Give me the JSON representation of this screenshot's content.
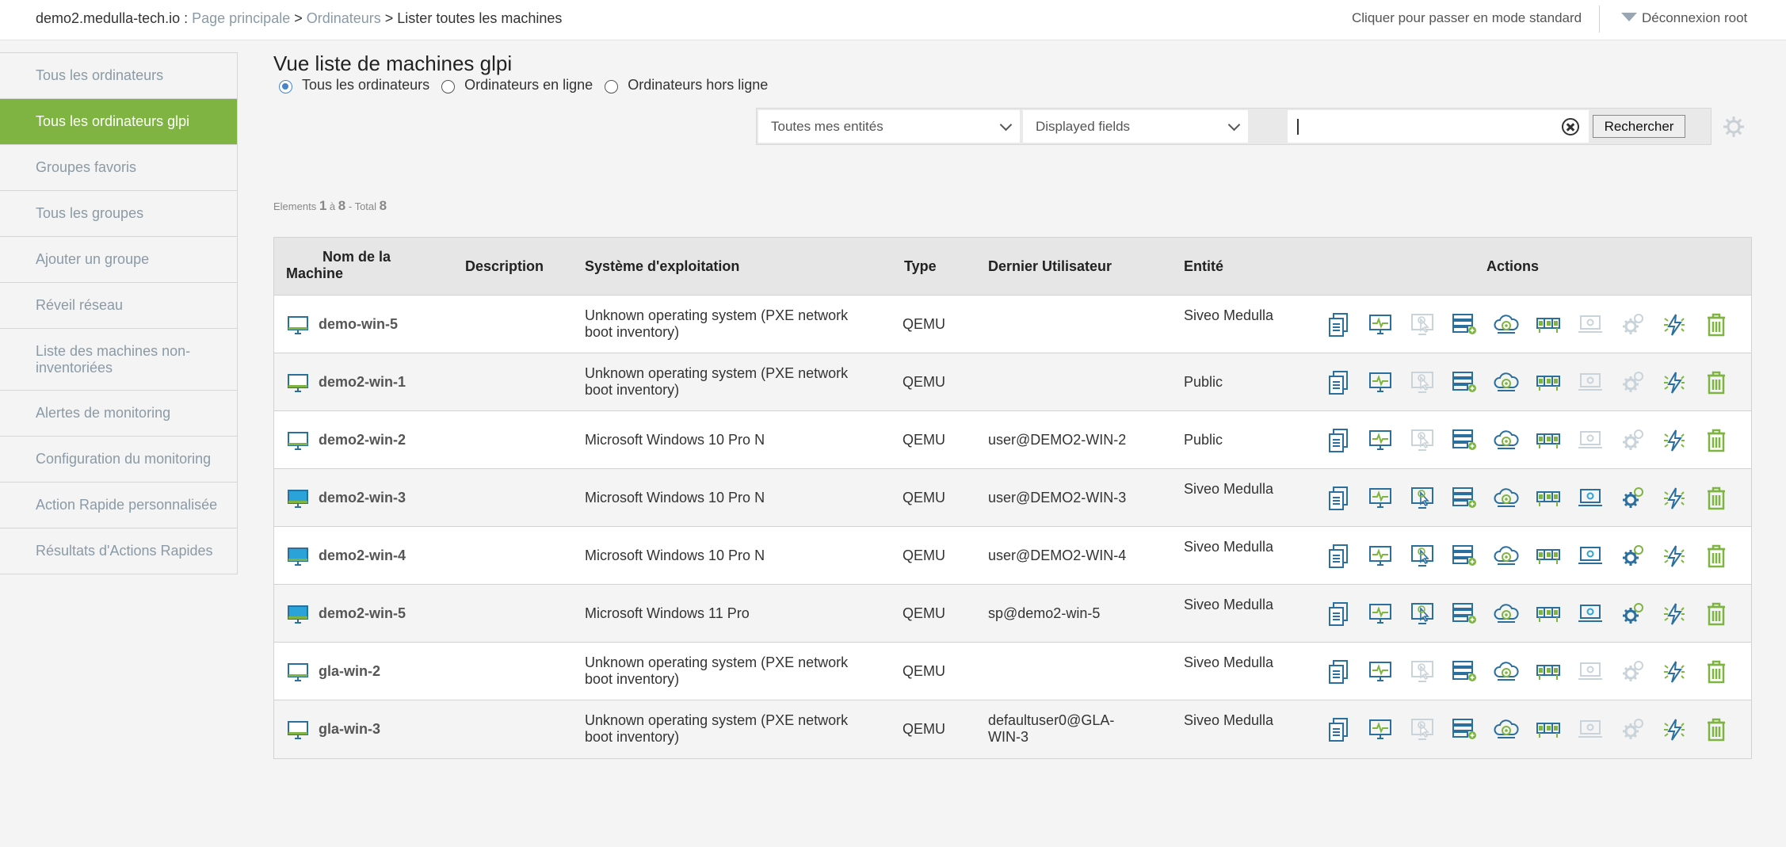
{
  "breadcrumb": {
    "host": "demo2.medulla-tech.io",
    "colon": " : ",
    "home": "Page principale",
    "computers": "Ordinateurs",
    "current": "Lister toutes les machines",
    "sep": " > "
  },
  "topbar": {
    "mode_link": "Cliquer pour passer en mode standard",
    "logout": "Déconnexion root"
  },
  "sidebar": {
    "items": [
      {
        "label": "Tous les ordinateurs"
      },
      {
        "label": "Tous les ordinateurs glpi",
        "active": true
      },
      {
        "label": "Groupes favoris"
      },
      {
        "label": "Tous les groupes"
      },
      {
        "label": "Ajouter un groupe"
      },
      {
        "label": "Réveil réseau"
      },
      {
        "label": "Liste des machines non-inventoriées"
      },
      {
        "label": "Alertes de monitoring"
      },
      {
        "label": "Configuration du monitoring"
      },
      {
        "label": "Action Rapide personnalisée"
      },
      {
        "label": "Résultats d'Actions Rapides"
      }
    ]
  },
  "main": {
    "title": "Vue liste de machines glpi",
    "radios": [
      {
        "label": "Tous les ordinateurs",
        "checked": true
      },
      {
        "label": "Ordinateurs en ligne"
      },
      {
        "label": "Ordinateurs hors ligne"
      }
    ],
    "filters": {
      "entities": "Toutes mes entités",
      "fields": "Displayed fields",
      "search_value": "",
      "search_button": "Rechercher"
    },
    "counter": {
      "prefix": "Elements",
      "from": "1",
      "mid": "à",
      "to": "8",
      "total_label": "- Total",
      "total": "8"
    }
  },
  "table": {
    "headers": {
      "name": "Nom de la Machine",
      "name_l1": "Nom de la",
      "name_l2": "Machine",
      "description": "Description",
      "os": "Système d'exploitation",
      "type": "Type",
      "user": "Dernier Utilisateur",
      "entity": "Entité",
      "actions": "Actions"
    },
    "action_icons": [
      "inventory-icon",
      "monitoring-icon",
      "remote-desktop-icon",
      "deploy-software-icon",
      "backup-icon",
      "imaging-icon",
      "console-icon",
      "quick-action-icon",
      "wake-on-lan-icon",
      "delete-icon"
    ],
    "rows": [
      {
        "name": "demo-win-5",
        "description": "",
        "os": "Unknown operating system (PXE network boot inventory)",
        "type": "QEMU",
        "user": "",
        "entity": "Siveo Medulla",
        "online": false
      },
      {
        "name": "demo2-win-1",
        "description": "",
        "os": "Unknown operating system (PXE network boot inventory)",
        "type": "QEMU",
        "user": "",
        "entity": "Public",
        "online": false
      },
      {
        "name": "demo2-win-2",
        "description": "",
        "os": "Microsoft Windows 10 Pro N",
        "type": "QEMU",
        "user": "user@DEMO2-WIN-2",
        "entity": "Public",
        "online": false
      },
      {
        "name": "demo2-win-3",
        "description": "",
        "os": "Microsoft Windows 10 Pro N",
        "type": "QEMU",
        "user": "user@DEMO2-WIN-3",
        "entity": "Siveo Medulla",
        "online": true
      },
      {
        "name": "demo2-win-4",
        "description": "",
        "os": "Microsoft Windows 10 Pro N",
        "type": "QEMU",
        "user": "user@DEMO2-WIN-4",
        "entity": "Siveo Medulla",
        "online": true
      },
      {
        "name": "demo2-win-5",
        "description": "",
        "os": "Microsoft Windows 11 Pro",
        "type": "QEMU",
        "user": "sp@demo2-win-5",
        "entity": "Siveo Medulla",
        "online": true
      },
      {
        "name": "gla-win-2",
        "description": "",
        "os": "Unknown operating system (PXE network boot inventory)",
        "type": "QEMU",
        "user": "",
        "entity": "Siveo Medulla",
        "online": false
      },
      {
        "name": "gla-win-3",
        "description": "",
        "os": "Unknown operating system (PXE network boot inventory)",
        "type": "QEMU",
        "user": "defaultuser0@GLA-WIN-3",
        "entity": "Siveo Medulla",
        "online": false
      }
    ]
  },
  "colors": {
    "accent": "#7fb442",
    "icon_blue": "#2a6f9e",
    "icon_green": "#7fb442",
    "icon_disabled": "#c9d3da",
    "online_screen": "#2aa3d8"
  }
}
